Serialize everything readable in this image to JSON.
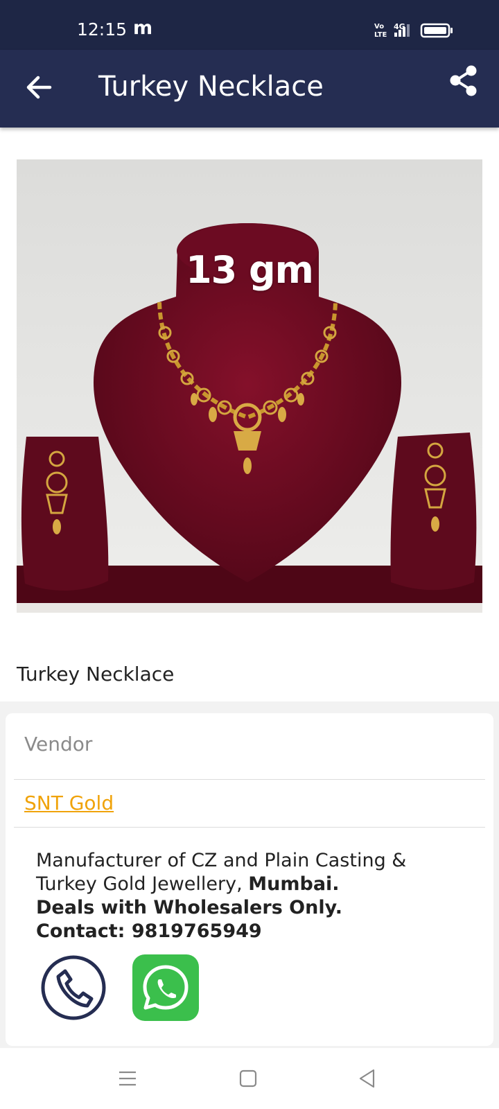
{
  "status_bar": {
    "time": "12:15",
    "notification": "m",
    "network": "4G",
    "volte": "Vo LTE"
  },
  "toolbar": {
    "title": "Turkey Necklace",
    "back_icon": "arrow-left-icon",
    "share_icon": "share-icon"
  },
  "product": {
    "image_label": "13 gm",
    "name": "Turkey Necklace"
  },
  "vendor": {
    "label": "Vendor",
    "name": "SNT Gold",
    "desc_line1": "Manufacturer of CZ and Plain Casting &",
    "desc_line2_prefix": "Turkey Gold Jewellery,",
    "desc_city": "Mumbai.",
    "desc_line3": "Deals with Wholesalers Only.",
    "desc_line4": "Contact: 9819765949"
  },
  "actions": {
    "call_icon": "phone-icon",
    "whatsapp_icon": "whatsapp-icon"
  },
  "nav": {
    "menu_icon": "menu-icon",
    "home_icon": "square-icon",
    "back_icon": "triangle-back-icon"
  },
  "colors": {
    "toolbar": "#252d52",
    "status_bar": "#1e2645",
    "vendor_link": "#f0a30a",
    "whatsapp": "#3bbf4c",
    "velvet": "#6e0a1f"
  }
}
